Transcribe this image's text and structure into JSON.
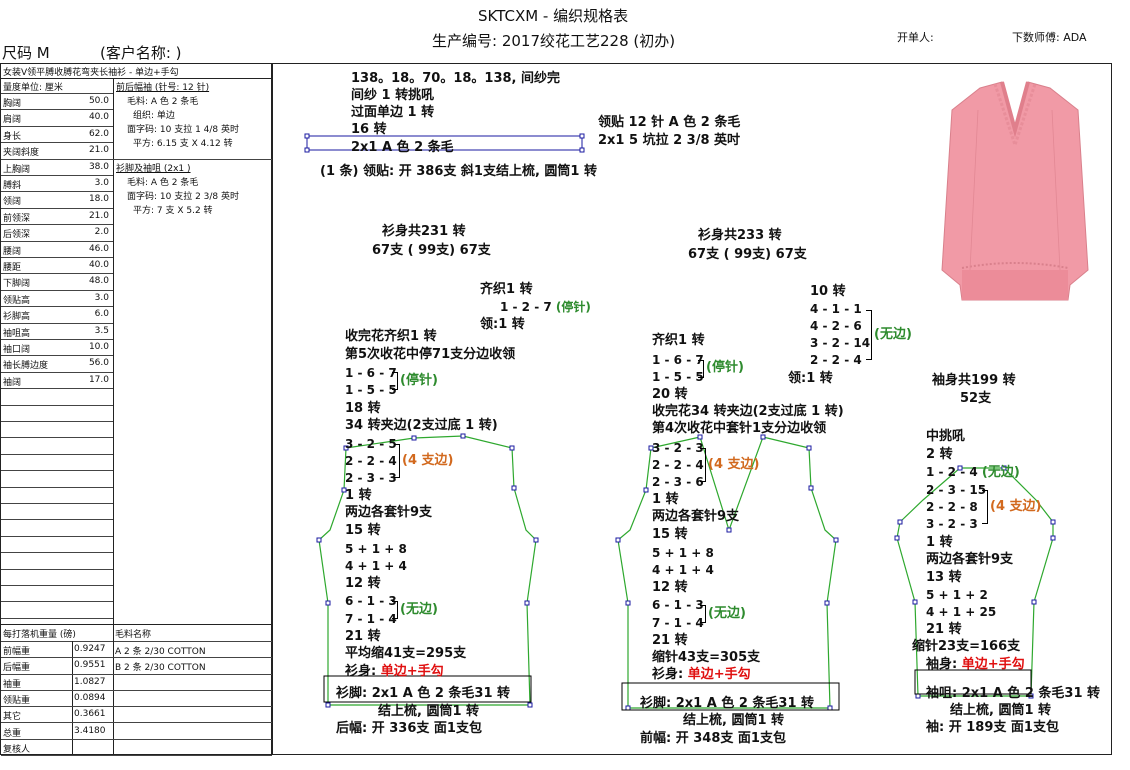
{
  "header": {
    "title": "SKTCXM - 编织规格表",
    "production_no": "生产编号: 2017绞花工艺228 (初办)",
    "opener": "开单人:",
    "master": "下数师傅: ADA",
    "size": "尺码  M",
    "customer": "(客户名称:               )"
  },
  "left": {
    "style_desc": "女装V领平膊收膊花弯夹长袖衫 - 单边+手勾",
    "unit_label": "量度单位: 厘米",
    "measurements": [
      {
        "label": "胸阔",
        "value": "50.0"
      },
      {
        "label": "肩阔",
        "value": "40.0"
      },
      {
        "label": "身长",
        "value": "62.0"
      },
      {
        "label": "夹阔斜度",
        "value": "21.0"
      },
      {
        "label": "上胸阔",
        "value": "38.0"
      },
      {
        "label": "膊斜",
        "value": "3.0"
      },
      {
        "label": "领阔",
        "value": "18.0"
      },
      {
        "label": "前领深",
        "value": "21.0"
      },
      {
        "label": "后领深",
        "value": "2.0"
      },
      {
        "label": "腰阔",
        "value": "46.0"
      },
      {
        "label": "腰距",
        "value": "40.0"
      },
      {
        "label": "下脚阔",
        "value": "48.0"
      },
      {
        "label": "领贴高",
        "value": "3.0"
      },
      {
        "label": "衫脚高",
        "value": "6.0"
      },
      {
        "label": "袖咀高",
        "value": "3.5"
      },
      {
        "label": "袖口阔",
        "value": "10.0"
      },
      {
        "label": "袖长膊边度",
        "value": "56.0"
      },
      {
        "label": "袖阔",
        "value": "17.0"
      }
    ],
    "body_fabric": {
      "heading": "前后幅袖 (针号: 12 针)",
      "lines": [
        "毛料: A 色 2 条毛",
        "组织: 单边",
        "面字码: 10 支拉 1 4/8 英时",
        "平方: 6.15 支 X 4.12 转"
      ]
    },
    "rib_fabric": {
      "heading": "衫脚及袖咀 (2x1 )",
      "lines": [
        "毛料: A 色 2 条毛",
        "面字码: 10 支拉 2 3/8 英时",
        "平方: 7 支 X 5.2 转"
      ]
    },
    "weights_header": "每打落机重量 (磅)",
    "materials_header": "毛料名称",
    "weights": [
      {
        "label": "前幅重",
        "value": "0.9247",
        "material": "A  2 条 2/30 COTTON"
      },
      {
        "label": "后幅重",
        "value": "0.9551",
        "material": "B  2 条 2/30 COTTON"
      },
      {
        "label": "袖重",
        "value": "1.0827",
        "material": ""
      },
      {
        "label": "领贴重",
        "value": "0.0894",
        "material": ""
      },
      {
        "label": "其它",
        "value": "0.3661",
        "material": ""
      },
      {
        "label": "总重",
        "value": "3.4180",
        "material": ""
      },
      {
        "label": "复核人",
        "value": "",
        "material": ""
      }
    ]
  },
  "collar": {
    "l1": "138。18。70。18。138, 间纱完",
    "l2": "间纱 1 转挑吼",
    "l3": "过面单边 1 转",
    "l4": "16 转",
    "l5": "2x1    A 色 2 条毛",
    "spec1": "领贴  12 针 A 色 2 条毛",
    "spec2": "2x1    5 坑拉 2 3/8 英吋",
    "summary": "(1 条) 领贴: 开 386支 斜1支结上梳, 圆筒1 转"
  },
  "back": {
    "total": "衫身共231 转",
    "width": "67支 ( 99支) 67支",
    "a1": "齐织1 转",
    "a2": "1 - 2 - 7",
    "a2n": "(停针)",
    "a3": "领:1 转",
    "b1": "收完花齐织1 转",
    "b2": "第5次收花中停71支分边收领",
    "b3": "1 - 6 - 7",
    "b4": "1 - 5 - 5",
    "b34n": "(停针)",
    "b5": "18 转",
    "b6": "34 转夹边(2支过底 1 转)",
    "c1": "3 - 2 - 5",
    "c2": "2 - 2 - 4",
    "c3": "2 - 3 - 3",
    "cn": "(4 支边)",
    "c4": "1 转",
    "c5": "两边各套针9支",
    "c6": "15 转",
    "c7": "5 + 1 + 8",
    "c8": "4 + 1 + 4",
    "c9": "12 转",
    "d1": "6 - 1 - 3",
    "d2": "7 - 1 - 4",
    "dn": "(无边)",
    "d3": "21 转",
    "d4": "平均缩41支=295支",
    "d5a": "衫身: ",
    "d5b": "单边+手勾",
    "e1": "衫脚: 2x1    A 色 2 条毛31 转",
    "e2": "结上梳, 圆筒1 转",
    "e3": "后幅: 开 336支 面1支包"
  },
  "front": {
    "total": "衫身共233 转",
    "width": "67支 ( 99支) 67支",
    "a1": "齐织1 转",
    "a2": "1 - 6 - 7",
    "a3": "1 - 5 - 5",
    "an": "(停针)",
    "a4": "20 转",
    "a5": "收完花34 转夹边(2支过底 1 转)",
    "a6": "第4次收花中套针1支分边收领",
    "c1": "3 - 2 - 3",
    "c2": "2 - 2 - 4",
    "c3": "2 - 3 - 6",
    "cn": "(4 支边)",
    "c4": "1 转",
    "c5": "两边各套针9支",
    "c6": "15 转",
    "c7": "5 + 1 + 8",
    "c8": "4 + 1 + 4",
    "c9": "12 转",
    "d1": "6 - 1 - 3",
    "d2": "7 - 1 - 4",
    "dn": "(无边)",
    "d3": "21 转",
    "d4": "缩针43支=305支",
    "d5a": "衫身: ",
    "d5b": "单边+手勾",
    "e1": "衫脚: 2x1    A 色 2 条毛31 转",
    "e2": "结上梳, 圆筒1 转",
    "e3": "前幅: 开 348支 面1支包",
    "neck1": "10 转",
    "neck2": "4 - 1 - 1",
    "neck3": "4 - 2 - 6",
    "neck4": "3 - 2 - 14",
    "neck5": "2 - 2 - 4",
    "neckn": "(无边)",
    "neck6": "领:1 转"
  },
  "sleeve": {
    "total": "袖身共199 转",
    "width": "52支",
    "a1": "中挑吼",
    "a2": "2 转",
    "a3": "1 - 2 - 4",
    "a3n": "(无边)",
    "a4": "2 - 3 - 15",
    "a5": "2 - 2 - 8",
    "a6": "3 - 2 - 3",
    "a45n": "(4 支边)",
    "a7": "1 转",
    "a8": "两边各套针9支",
    "a9": "13 转",
    "a10": "5 + 1 + 2",
    "a11": "4 + 1 + 25",
    "a12": "21 转",
    "a13": "缩针23支=166支",
    "a14a": "袖身: ",
    "a14b": "单边+手勾",
    "e1": "袖咀: 2x1    A 色 2 条毛31 转",
    "e2": "结上梳, 圆筒1 转",
    "e3": "袖: 开 189支 面1支包"
  },
  "colors": {
    "stopped": "#2e8b2e",
    "edge4": "#d2691e",
    "body": "#e01010",
    "outline": "#2ea82e",
    "sweater": "#f19aa6"
  }
}
